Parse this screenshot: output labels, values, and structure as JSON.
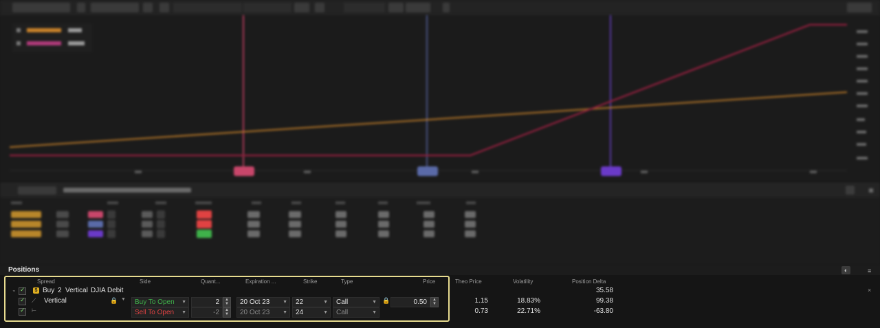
{
  "colors": {
    "buy": "#3fb24a",
    "sell": "#e04242",
    "highlight": "#e8dc90",
    "debit_badge": "#e0b020",
    "series_a": "#c8822a",
    "series_b": "#8c1f3c",
    "marker_pink": "#c8466a",
    "marker_blue": "#5a6aa8",
    "marker_purple": "#6a3ac8"
  },
  "positions": {
    "title": "Positions",
    "columns": {
      "spread": "Spread",
      "side": "Side",
      "quantity": "Quant...",
      "expiration": "Expiration ...",
      "strike": "Strike",
      "type": "Type",
      "price": "Price",
      "theo_price": "Theo Price",
      "volatility": "Volatility",
      "position_delta": "Position Delta"
    },
    "group": {
      "side_word": "Buy",
      "quantity": "2",
      "strategy": "Vertical",
      "symbol": "DJIA",
      "debit_credit": "Debit",
      "position_delta": "35.58"
    },
    "legs": [
      {
        "spread": "Vertical",
        "side": "Buy To Open",
        "quantity": "2",
        "expiration": "20 Oct 23",
        "strike": "22",
        "type": "Call",
        "price": "0.50",
        "theo_price": "1.15",
        "volatility": "18.83%",
        "position_delta": "99.38"
      },
      {
        "spread": "",
        "side": "Sell To Open",
        "quantity": "-2",
        "expiration": "20 Oct 23",
        "strike": "24",
        "type": "Call",
        "price": "",
        "theo_price": "0.73",
        "volatility": "22.71%",
        "position_delta": "-63.80"
      }
    ]
  }
}
